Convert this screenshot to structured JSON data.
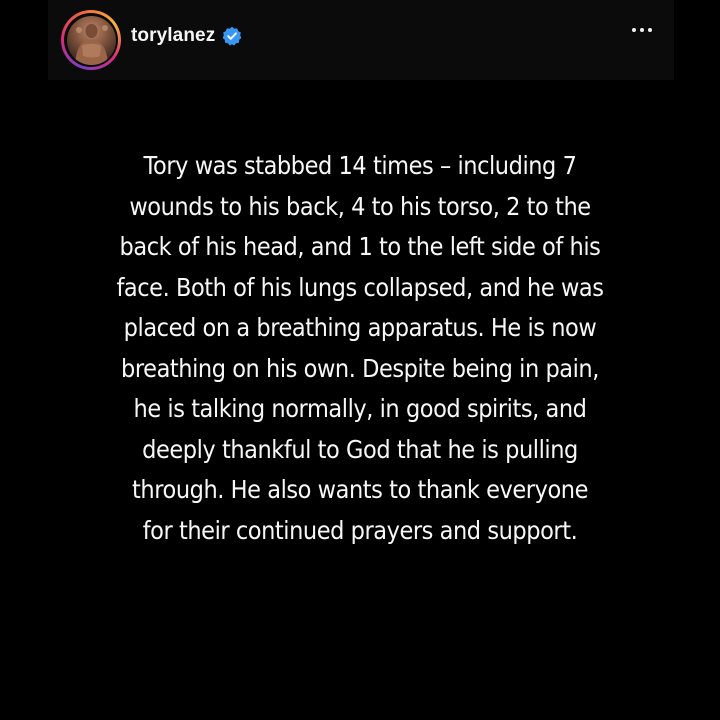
{
  "header": {
    "username": "torylanez",
    "verified_icon": "verified-badge-icon",
    "more_icon": "more-options-icon",
    "avatar_icon": "profile-avatar"
  },
  "post": {
    "lines": [
      "Tory was stabbed 14 times – including 7",
      "wounds to his back, 4 to his torso, 2 to the",
      "back of his head, and 1 to the left side of his",
      "face. Both of his lungs collapsed, and he was",
      "placed on a breathing apparatus. He is now",
      "breathing on his own. Despite being in pain,",
      "he is talking normally, in good spirits, and",
      "deeply thankful to God that he is pulling",
      "through. He also wants to thank everyone",
      "for their continued prayers and support."
    ]
  },
  "colors": {
    "background": "#000000",
    "header_background": "#0b0b0b",
    "verified_blue": "#3897f0",
    "text": "#f7f7f7"
  }
}
